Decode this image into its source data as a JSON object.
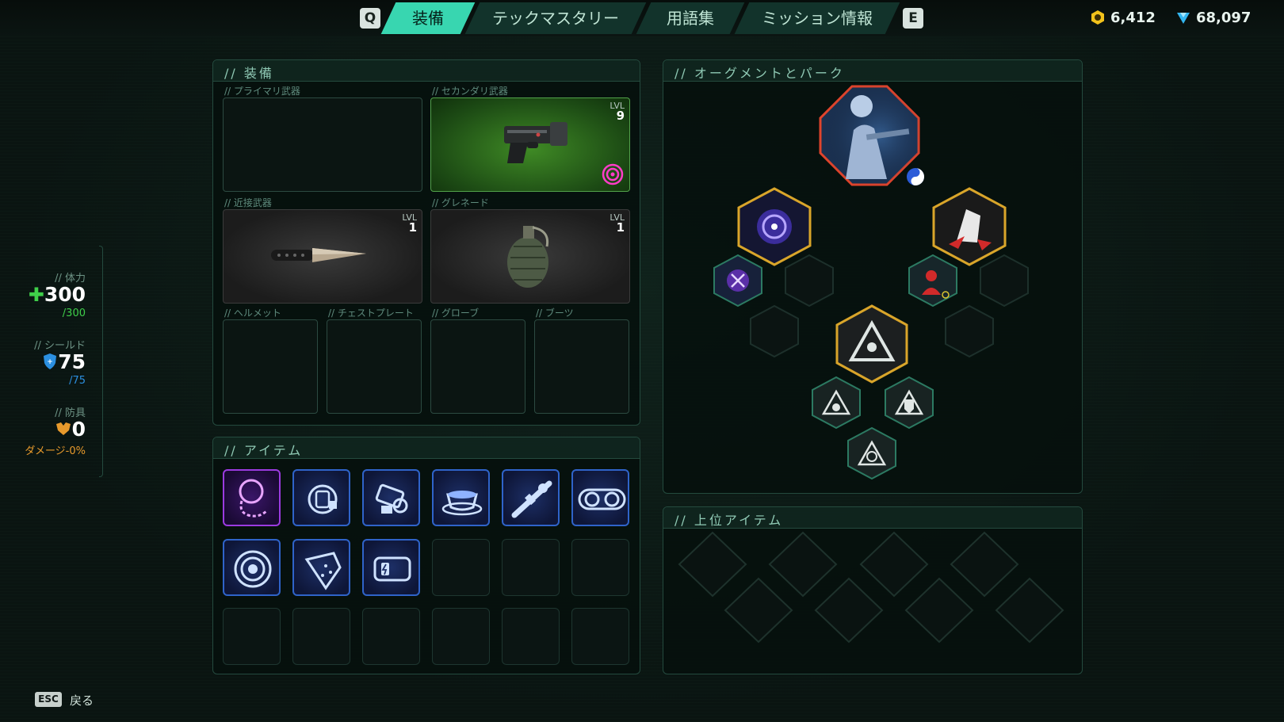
{
  "tabs": {
    "prev_key": "Q",
    "next_key": "E",
    "items": [
      {
        "label": "装備",
        "active": true
      },
      {
        "label": "テックマスタリー",
        "active": false
      },
      {
        "label": "用語集",
        "active": false
      },
      {
        "label": "ミッション情報",
        "active": false
      }
    ]
  },
  "currency": {
    "coins": "6,412",
    "gems": "68,097"
  },
  "stats": {
    "health_label": "// 体力",
    "health_value": "300",
    "health_max": "/300",
    "shield_label": "// シールド",
    "shield_value": "75",
    "shield_max": "/75",
    "armor_label": "// 防具",
    "armor_value": "0",
    "armor_damage": "ダメージ-0%"
  },
  "equipment": {
    "title": "// 装備",
    "primary_label": "// プライマリ武器",
    "secondary_label": "// セカンダリ武器",
    "secondary_lvl_label": "LVL",
    "secondary_lvl": "9",
    "melee_label": "// 近接武器",
    "melee_lvl_label": "LVL",
    "melee_lvl": "1",
    "grenade_label": "// グレネード",
    "grenade_lvl_label": "LVL",
    "grenade_lvl": "1",
    "helmet_label": "// ヘルメット",
    "chest_label": "// チェストプレート",
    "gloves_label": "// グローブ",
    "boots_label": "// ブーツ"
  },
  "items_panel": {
    "title": "// アイテム",
    "items": [
      {
        "icon": "chain-pendant-icon",
        "rarity": "epic"
      },
      {
        "icon": "canister-icon",
        "rarity": "rare"
      },
      {
        "icon": "machine-part-icon",
        "rarity": "rare"
      },
      {
        "icon": "coffee-cup-icon",
        "rarity": "rare"
      },
      {
        "icon": "scope-icon",
        "rarity": "rare"
      },
      {
        "icon": "goggles-icon",
        "rarity": "rare"
      },
      {
        "icon": "eye-lens-icon",
        "rarity": "rare"
      },
      {
        "icon": "crystal-shard-icon",
        "rarity": "rare"
      },
      {
        "icon": "battery-icon",
        "rarity": "rare"
      }
    ]
  },
  "augments": {
    "title": "// オーグメントとパーク"
  },
  "upper_items": {
    "title": "// 上位アイテム"
  },
  "footer": {
    "esc_key": "ESC",
    "back_label": "戻る"
  },
  "colors": {
    "accent": "#38d6b0",
    "health": "#3fcf4a",
    "shield": "#2b8fe0",
    "armor": "#e89a2c",
    "rare": "#2f63c9",
    "epic": "#9b3be0",
    "gold_hex": "#d9a52a",
    "red_hex": "#e0442c"
  }
}
